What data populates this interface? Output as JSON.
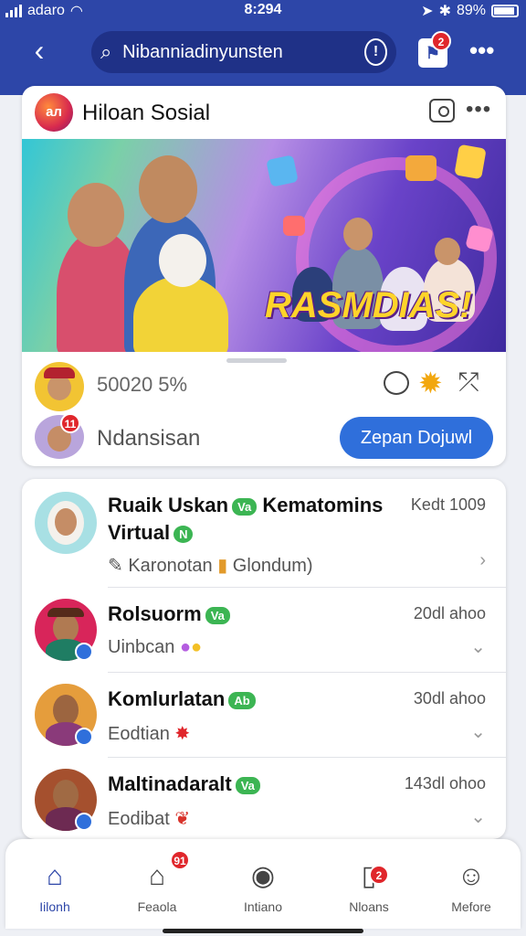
{
  "status": {
    "carrier": "adaro",
    "time": "8:294",
    "battery": "89%"
  },
  "header": {
    "search_value": "Nibanniadinyunsten",
    "notif_badge": "2"
  },
  "post": {
    "page_name": "Hiloan Sosial",
    "logo_text": "ал",
    "banner_title": "RASMDIAS!",
    "stat_text": "50020 5%",
    "friend_name": "Ndansisan",
    "friend_badge": "11",
    "open_button": "Zepan Dojuwl"
  },
  "list": [
    {
      "title": "Ruaik Uskan",
      "tag": "Va",
      "title2": "Kematomins",
      "line2": "Virtual",
      "line2_tag": "N",
      "time": "Kedt 1009",
      "sub": "Karonotan",
      "sub2": "Glondum)",
      "colors": {
        "bg": "#a8e0e4"
      }
    },
    {
      "title": "Rolsuorm",
      "tag": "Va",
      "time": "20dl ahoo",
      "sub": "Uinbcan",
      "colors": {
        "bg": "#d8255a"
      }
    },
    {
      "title": "Komlurlatan",
      "tag": "Ab",
      "time": "30dl ahoo",
      "sub": "Eodtian",
      "colors": {
        "bg": "#e59d3c"
      }
    },
    {
      "title": "Maltinadaralt",
      "tag": "Va",
      "time": "143dl ohoo",
      "sub": "Eodibat",
      "colors": {
        "bg": "#a5502e"
      }
    }
  ],
  "nav": {
    "items": [
      {
        "label": "Iilonh",
        "icon": "home-icon"
      },
      {
        "label": "Feaola",
        "icon": "house-icon"
      },
      {
        "label": "Intiano",
        "icon": "camera-icon"
      },
      {
        "label": "Nloans",
        "icon": "phone-icon"
      },
      {
        "label": "Mefore",
        "icon": "profile-icon"
      }
    ],
    "feed_badge": "91",
    "phone_badge": "2"
  },
  "colors": {
    "header": "#2d46a8",
    "accent": "#2f6fdb",
    "tag": "#3cb553",
    "badge": "#e0262b"
  }
}
